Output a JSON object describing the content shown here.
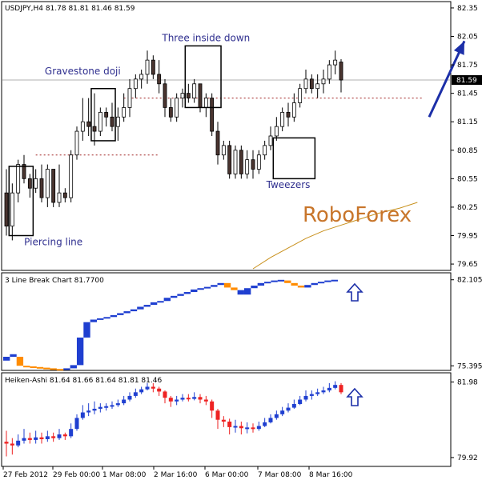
{
  "chart_data": [
    {
      "type": "candlestick",
      "title": "USDJPY,H4  81.78 81.81 81.46 81.59",
      "current_price": "81.59",
      "ylim": [
        79.6,
        82.4
      ],
      "y_ticks": [
        "82.35",
        "82.05",
        "81.75",
        "81.45",
        "81.15",
        "80.85",
        "80.55",
        "80.25",
        "79.95",
        "79.65"
      ],
      "candles": [
        [
          80.4,
          80.65,
          79.95,
          80.05
        ],
        [
          80.05,
          80.5,
          79.9,
          80.4
        ],
        [
          80.4,
          80.75,
          80.3,
          80.7
        ],
        [
          80.7,
          80.8,
          80.5,
          80.55
        ],
        [
          80.55,
          80.6,
          80.35,
          80.45
        ],
        [
          80.45,
          80.65,
          80.4,
          80.55
        ],
        [
          80.55,
          80.7,
          80.3,
          80.35
        ],
        [
          80.35,
          80.7,
          80.25,
          80.65
        ],
        [
          80.65,
          80.65,
          80.25,
          80.3
        ],
        [
          80.3,
          80.7,
          80.25,
          80.4
        ],
        [
          80.4,
          80.45,
          80.3,
          80.35
        ],
        [
          80.35,
          80.85,
          80.3,
          80.8
        ],
        [
          80.8,
          81.1,
          80.75,
          81.05
        ],
        [
          81.05,
          81.4,
          80.95,
          81.15
        ],
        [
          81.15,
          81.4,
          81.0,
          81.1
        ],
        [
          81.1,
          81.45,
          80.9,
          81.05
        ],
        [
          81.05,
          81.3,
          81.0,
          81.25
        ],
        [
          81.25,
          81.3,
          81.1,
          81.2
        ],
        [
          81.2,
          81.35,
          81.05,
          81.1
        ],
        [
          81.1,
          81.3,
          80.95,
          81.2
        ],
        [
          81.2,
          81.45,
          81.15,
          81.3
        ],
        [
          81.3,
          81.6,
          81.2,
          81.5
        ],
        [
          81.5,
          81.65,
          81.4,
          81.6
        ],
        [
          81.6,
          81.7,
          81.5,
          81.65
        ],
        [
          81.65,
          81.9,
          81.55,
          81.8
        ],
        [
          81.8,
          81.85,
          81.6,
          81.65
        ],
        [
          81.65,
          81.8,
          81.45,
          81.55
        ],
        [
          81.55,
          81.6,
          81.2,
          81.3
        ],
        [
          81.3,
          81.4,
          81.15,
          81.2
        ],
        [
          81.2,
          81.45,
          81.15,
          81.4
        ],
        [
          81.4,
          81.5,
          81.3,
          81.45
        ],
        [
          81.45,
          81.55,
          81.35,
          81.4
        ],
        [
          81.4,
          81.6,
          81.35,
          81.55
        ],
        [
          81.55,
          81.55,
          81.25,
          81.3
        ],
        [
          81.3,
          81.45,
          81.2,
          81.4
        ],
        [
          81.4,
          81.45,
          81.0,
          81.05
        ],
        [
          81.05,
          81.15,
          80.7,
          80.8
        ],
        [
          80.8,
          80.95,
          80.75,
          80.9
        ],
        [
          80.9,
          80.95,
          80.55,
          80.6
        ],
        [
          80.6,
          80.9,
          80.55,
          80.85
        ],
        [
          80.85,
          80.9,
          80.55,
          80.6
        ],
        [
          80.6,
          80.85,
          80.55,
          80.75
        ],
        [
          80.75,
          80.85,
          80.55,
          80.65
        ],
        [
          80.65,
          80.85,
          80.6,
          80.8
        ],
        [
          80.8,
          80.95,
          80.75,
          80.9
        ],
        [
          80.9,
          81.1,
          80.85,
          81.0
        ],
        [
          81.0,
          81.2,
          80.95,
          81.1
        ],
        [
          81.1,
          81.3,
          81.05,
          81.25
        ],
        [
          81.25,
          81.35,
          81.1,
          81.2
        ],
        [
          81.2,
          81.45,
          81.15,
          81.35
        ],
        [
          81.35,
          81.55,
          81.3,
          81.5
        ],
        [
          81.5,
          81.7,
          81.45,
          81.6
        ],
        [
          81.6,
          81.65,
          81.45,
          81.5
        ],
        [
          81.5,
          81.65,
          81.4,
          81.55
        ],
        [
          81.55,
          81.7,
          81.45,
          81.6
        ],
        [
          81.6,
          81.8,
          81.55,
          81.75
        ],
        [
          81.75,
          81.9,
          81.65,
          81.8
        ],
        [
          81.78,
          81.81,
          81.46,
          81.59
        ]
      ],
      "ma": [
        [
          42,
          79.6
        ],
        [
          45,
          79.72
        ],
        [
          48,
          79.82
        ],
        [
          51,
          79.92
        ],
        [
          54,
          80.0
        ],
        [
          57,
          80.06
        ],
        [
          60,
          80.12
        ],
        [
          63,
          80.18
        ],
        [
          67,
          80.24
        ],
        [
          70,
          80.3
        ]
      ],
      "dotted_levels": [
        {
          "from": 5,
          "to": 26,
          "value": 80.8
        },
        {
          "from": 20,
          "to": 71,
          "value": 81.4
        }
      ],
      "annotations": [
        {
          "label": "Gravestone doji",
          "price": 81.65,
          "index": 13
        },
        {
          "label": "Three inside down",
          "price": 82.0,
          "index": 34
        },
        {
          "label": "Piercing line",
          "price": 79.85,
          "index": 8
        },
        {
          "label": "Tweezers",
          "price": 80.45,
          "index": 48
        }
      ],
      "pattern_boxes": [
        {
          "from": 1,
          "to": 4,
          "low": 79.95,
          "high": 80.68
        },
        {
          "from": 15,
          "to": 18,
          "low": 80.95,
          "high": 81.5
        },
        {
          "from": 31,
          "to": 36,
          "low": 81.3,
          "high": 81.95
        },
        {
          "from": 46,
          "to": 52,
          "low": 80.55,
          "high": 80.98
        }
      ],
      "arrow": {
        "from": [
          72,
          81.2
        ],
        "to": [
          78,
          82.0
        ]
      },
      "watermark": "RoboForex"
    },
    {
      "type": "line_break",
      "title": "3 Line Break Chart 81.7700",
      "y_ticks": [
        "82.105",
        "75.395"
      ],
      "ylim": [
        75.1,
        82.4
      ],
      "bricks": [
        {
          "open": 75.8,
          "close": 76.1,
          "color": "#1f3fd0"
        },
        {
          "open": 76.1,
          "close": 76.3,
          "color": "#1f3fd0"
        },
        {
          "open": 76.1,
          "close": 75.4,
          "color": "#ff8c00"
        },
        {
          "open": 75.4,
          "close": 75.35,
          "color": "#ff8c00"
        },
        {
          "open": 75.35,
          "close": 75.3,
          "color": "#ff8c00"
        },
        {
          "open": 75.3,
          "close": 75.25,
          "color": "#ff8c00"
        },
        {
          "open": 75.25,
          "close": 75.2,
          "color": "#ff8c00"
        },
        {
          "open": 75.2,
          "close": 75.15,
          "color": "#ff8c00"
        },
        {
          "open": 75.15,
          "close": 75.1,
          "color": "#ff8c00"
        },
        {
          "open": 75.1,
          "close": 75.2,
          "color": "#1f3fd0"
        },
        {
          "open": 75.2,
          "close": 75.45,
          "color": "#1f3fd0"
        },
        {
          "open": 75.45,
          "close": 77.6,
          "color": "#1f3fd0"
        },
        {
          "open": 77.6,
          "close": 78.8,
          "color": "#1f3fd0"
        },
        {
          "open": 78.8,
          "close": 79.0,
          "color": "#1f3fd0"
        },
        {
          "open": 79.0,
          "close": 79.1,
          "color": "#1f3fd0"
        },
        {
          "open": 79.1,
          "close": 79.2,
          "color": "#1f3fd0"
        },
        {
          "open": 79.2,
          "close": 79.35,
          "color": "#1f3fd0"
        },
        {
          "open": 79.35,
          "close": 79.5,
          "color": "#1f3fd0"
        },
        {
          "open": 79.5,
          "close": 79.65,
          "color": "#1f3fd0"
        },
        {
          "open": 79.65,
          "close": 79.8,
          "color": "#1f3fd0"
        },
        {
          "open": 79.8,
          "close": 80.0,
          "color": "#1f3fd0"
        },
        {
          "open": 80.0,
          "close": 80.15,
          "color": "#1f3fd0"
        },
        {
          "open": 80.15,
          "close": 80.35,
          "color": "#1f3fd0"
        },
        {
          "open": 80.35,
          "close": 80.45,
          "color": "#1f3fd0"
        },
        {
          "open": 80.45,
          "close": 80.7,
          "color": "#1f3fd0"
        },
        {
          "open": 80.7,
          "close": 80.85,
          "color": "#1f3fd0"
        },
        {
          "open": 80.85,
          "close": 81.0,
          "color": "#1f3fd0"
        },
        {
          "open": 81.0,
          "close": 81.15,
          "color": "#1f3fd0"
        },
        {
          "open": 81.15,
          "close": 81.35,
          "color": "#1f3fd0"
        },
        {
          "open": 81.35,
          "close": 81.45,
          "color": "#1f3fd0"
        },
        {
          "open": 81.45,
          "close": 81.55,
          "color": "#1f3fd0"
        },
        {
          "open": 81.55,
          "close": 81.7,
          "color": "#1f3fd0"
        },
        {
          "open": 81.7,
          "close": 81.85,
          "color": "#1f3fd0"
        },
        {
          "open": 81.85,
          "close": 81.5,
          "color": "#ff8c00"
        },
        {
          "open": 81.5,
          "close": 81.3,
          "color": "#ff8c00"
        },
        {
          "open": 81.3,
          "close": 80.95,
          "color": "#1f3fd0"
        },
        {
          "open": 80.95,
          "close": 81.45,
          "color": "#1f3fd0"
        },
        {
          "open": 81.45,
          "close": 81.65,
          "color": "#1f3fd0"
        },
        {
          "open": 81.65,
          "close": 81.85,
          "color": "#1f3fd0"
        },
        {
          "open": 81.85,
          "close": 81.95,
          "color": "#1f3fd0"
        },
        {
          "open": 81.95,
          "close": 82.05,
          "color": "#1f3fd0"
        },
        {
          "open": 82.05,
          "close": 82.1,
          "color": "#1f3fd0"
        },
        {
          "open": 82.05,
          "close": 81.85,
          "color": "#ff8c00"
        },
        {
          "open": 81.85,
          "close": 81.65,
          "color": "#ff8c00"
        },
        {
          "open": 81.65,
          "close": 81.5,
          "color": "#ff8c00"
        },
        {
          "open": 81.5,
          "close": 81.7,
          "color": "#1f3fd0"
        },
        {
          "open": 81.7,
          "close": 81.85,
          "color": "#1f3fd0"
        },
        {
          "open": 81.85,
          "close": 81.95,
          "color": "#1f3fd0"
        },
        {
          "open": 81.95,
          "close": 82.05,
          "color": "#1f3fd0"
        },
        {
          "open": 82.05,
          "close": 82.105,
          "color": "#1f3fd0"
        }
      ]
    },
    {
      "type": "heiken_ashi",
      "title": "Heiken-Ashi 81.64 81.66 81.64 81.81 81.46",
      "y_ticks": [
        "81.98",
        "79.92"
      ],
      "ylim": [
        79.7,
        82.1
      ],
      "candles": [
        [
          80.35,
          80.3,
          80.65,
          79.95
        ],
        [
          80.3,
          80.25,
          80.45,
          80.0
        ],
        [
          80.25,
          80.38,
          80.55,
          80.2
        ],
        [
          80.38,
          80.45,
          80.7,
          80.3
        ],
        [
          80.45,
          80.4,
          80.6,
          80.3
        ],
        [
          80.4,
          80.47,
          80.65,
          80.3
        ],
        [
          80.47,
          80.42,
          80.6,
          80.3
        ],
        [
          80.42,
          80.5,
          80.65,
          80.35
        ],
        [
          80.5,
          80.45,
          80.6,
          80.35
        ],
        [
          80.45,
          80.55,
          80.7,
          80.4
        ],
        [
          80.55,
          80.5,
          80.6,
          80.4
        ],
        [
          80.5,
          80.7,
          80.85,
          80.45
        ],
        [
          80.7,
          81.0,
          81.1,
          80.65
        ],
        [
          81.0,
          81.15,
          81.35,
          80.95
        ],
        [
          81.15,
          81.2,
          81.4,
          81.05
        ],
        [
          81.2,
          81.25,
          81.45,
          81.1
        ],
        [
          81.25,
          81.3,
          81.4,
          81.15
        ],
        [
          81.3,
          81.32,
          81.4,
          81.2
        ],
        [
          81.32,
          81.35,
          81.45,
          81.25
        ],
        [
          81.35,
          81.4,
          81.5,
          81.3
        ],
        [
          81.4,
          81.5,
          81.6,
          81.35
        ],
        [
          81.5,
          81.6,
          81.7,
          81.45
        ],
        [
          81.6,
          81.7,
          81.8,
          81.55
        ],
        [
          81.7,
          81.78,
          81.85,
          81.65
        ],
        [
          81.78,
          81.85,
          81.95,
          81.75
        ],
        [
          81.85,
          81.8,
          81.95,
          81.7
        ],
        [
          81.8,
          81.72,
          81.85,
          81.6
        ],
        [
          81.72,
          81.55,
          81.75,
          81.4
        ],
        [
          81.55,
          81.45,
          81.6,
          81.3
        ],
        [
          81.45,
          81.5,
          81.6,
          81.35
        ],
        [
          81.5,
          81.55,
          81.65,
          81.45
        ],
        [
          81.55,
          81.52,
          81.65,
          81.45
        ],
        [
          81.52,
          81.57,
          81.7,
          81.48
        ],
        [
          81.57,
          81.5,
          81.65,
          81.4
        ],
        [
          81.5,
          81.45,
          81.6,
          81.35
        ],
        [
          81.45,
          81.2,
          81.5,
          81.0
        ],
        [
          81.2,
          80.95,
          81.25,
          80.7
        ],
        [
          80.95,
          80.9,
          81.05,
          80.75
        ],
        [
          80.9,
          80.75,
          80.98,
          80.55
        ],
        [
          80.75,
          80.78,
          80.95,
          80.6
        ],
        [
          80.78,
          80.72,
          80.9,
          80.55
        ],
        [
          80.72,
          80.74,
          80.88,
          80.58
        ],
        [
          80.74,
          80.7,
          80.85,
          80.6
        ],
        [
          80.7,
          80.78,
          80.9,
          80.65
        ],
        [
          80.78,
          80.88,
          81.0,
          80.75
        ],
        [
          80.88,
          81.0,
          81.1,
          80.85
        ],
        [
          81.0,
          81.1,
          81.2,
          80.95
        ],
        [
          81.1,
          81.2,
          81.3,
          81.05
        ],
        [
          81.2,
          81.28,
          81.4,
          81.15
        ],
        [
          81.28,
          81.38,
          81.5,
          81.25
        ],
        [
          81.38,
          81.5,
          81.6,
          81.35
        ],
        [
          81.5,
          81.6,
          81.75,
          81.45
        ],
        [
          81.6,
          81.65,
          81.75,
          81.5
        ],
        [
          81.65,
          81.7,
          81.8,
          81.6
        ],
        [
          81.7,
          81.75,
          81.85,
          81.65
        ],
        [
          81.75,
          81.82,
          81.95,
          81.7
        ],
        [
          81.82,
          81.9,
          82.0,
          81.78
        ],
        [
          81.9,
          81.7,
          81.95,
          81.65
        ]
      ]
    }
  ],
  "x_labels": [
    "27 Feb 2012",
    "29 Feb 00:00",
    "1 Mar 08:00",
    "2 Mar 16:00",
    "6 Mar 00:00",
    "7 Mar 08:00",
    "8 Mar 16:00"
  ],
  "colors": {
    "bull": "#ffffff",
    "bear": "#4a3530",
    "frame": "#000000",
    "ma": "#c8901c",
    "arrow": "#1c2fa8",
    "label": "#2f2f8f",
    "watermark": "#c8752a",
    "lb_up": "#1f3fd0",
    "lb_down": "#ff8c00",
    "ha_up": "#1f3fd0",
    "ha_down": "#ee2222"
  }
}
